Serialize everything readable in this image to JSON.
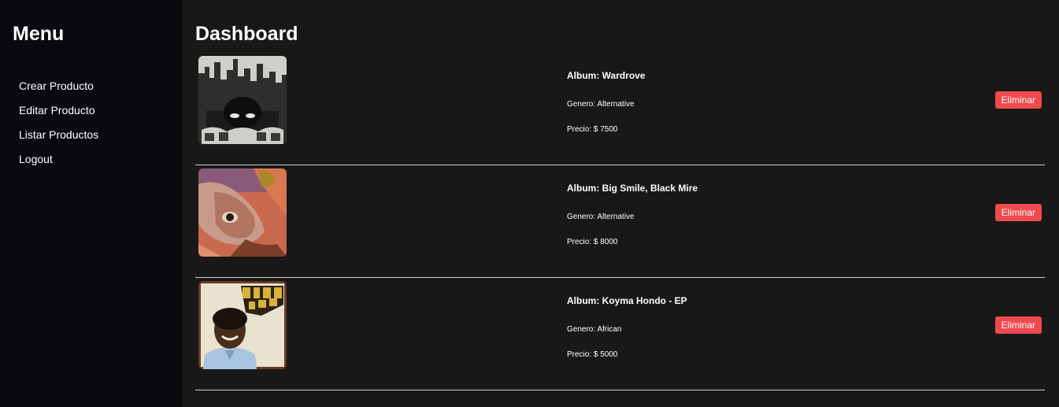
{
  "sidebar": {
    "title": "Menu",
    "items": [
      {
        "label": "Crear Producto"
      },
      {
        "label": "Editar Producto"
      },
      {
        "label": "Listar Productos"
      },
      {
        "label": "Logout"
      }
    ]
  },
  "main": {
    "title": "Dashboard",
    "products": [
      {
        "album": "Album: Wardrove",
        "genre": "Genero: Alternative",
        "price": "Precio: $ 7500",
        "delete_label": "Eliminar"
      },
      {
        "album": "Album: Big Smile, Black Mire",
        "genre": "Genero: Alternative",
        "price": "Precio: $ 8000",
        "delete_label": "Eliminar"
      },
      {
        "album": "Album: Koyma Hondo - EP",
        "genre": "Genero: African",
        "price": "Precio: $ 5000",
        "delete_label": "Eliminar"
      }
    ]
  },
  "colors": {
    "sidebar_bg": "#0a090d",
    "main_bg": "#181818",
    "delete_button": "#f04a4e",
    "divider": "#cfcfcf"
  }
}
